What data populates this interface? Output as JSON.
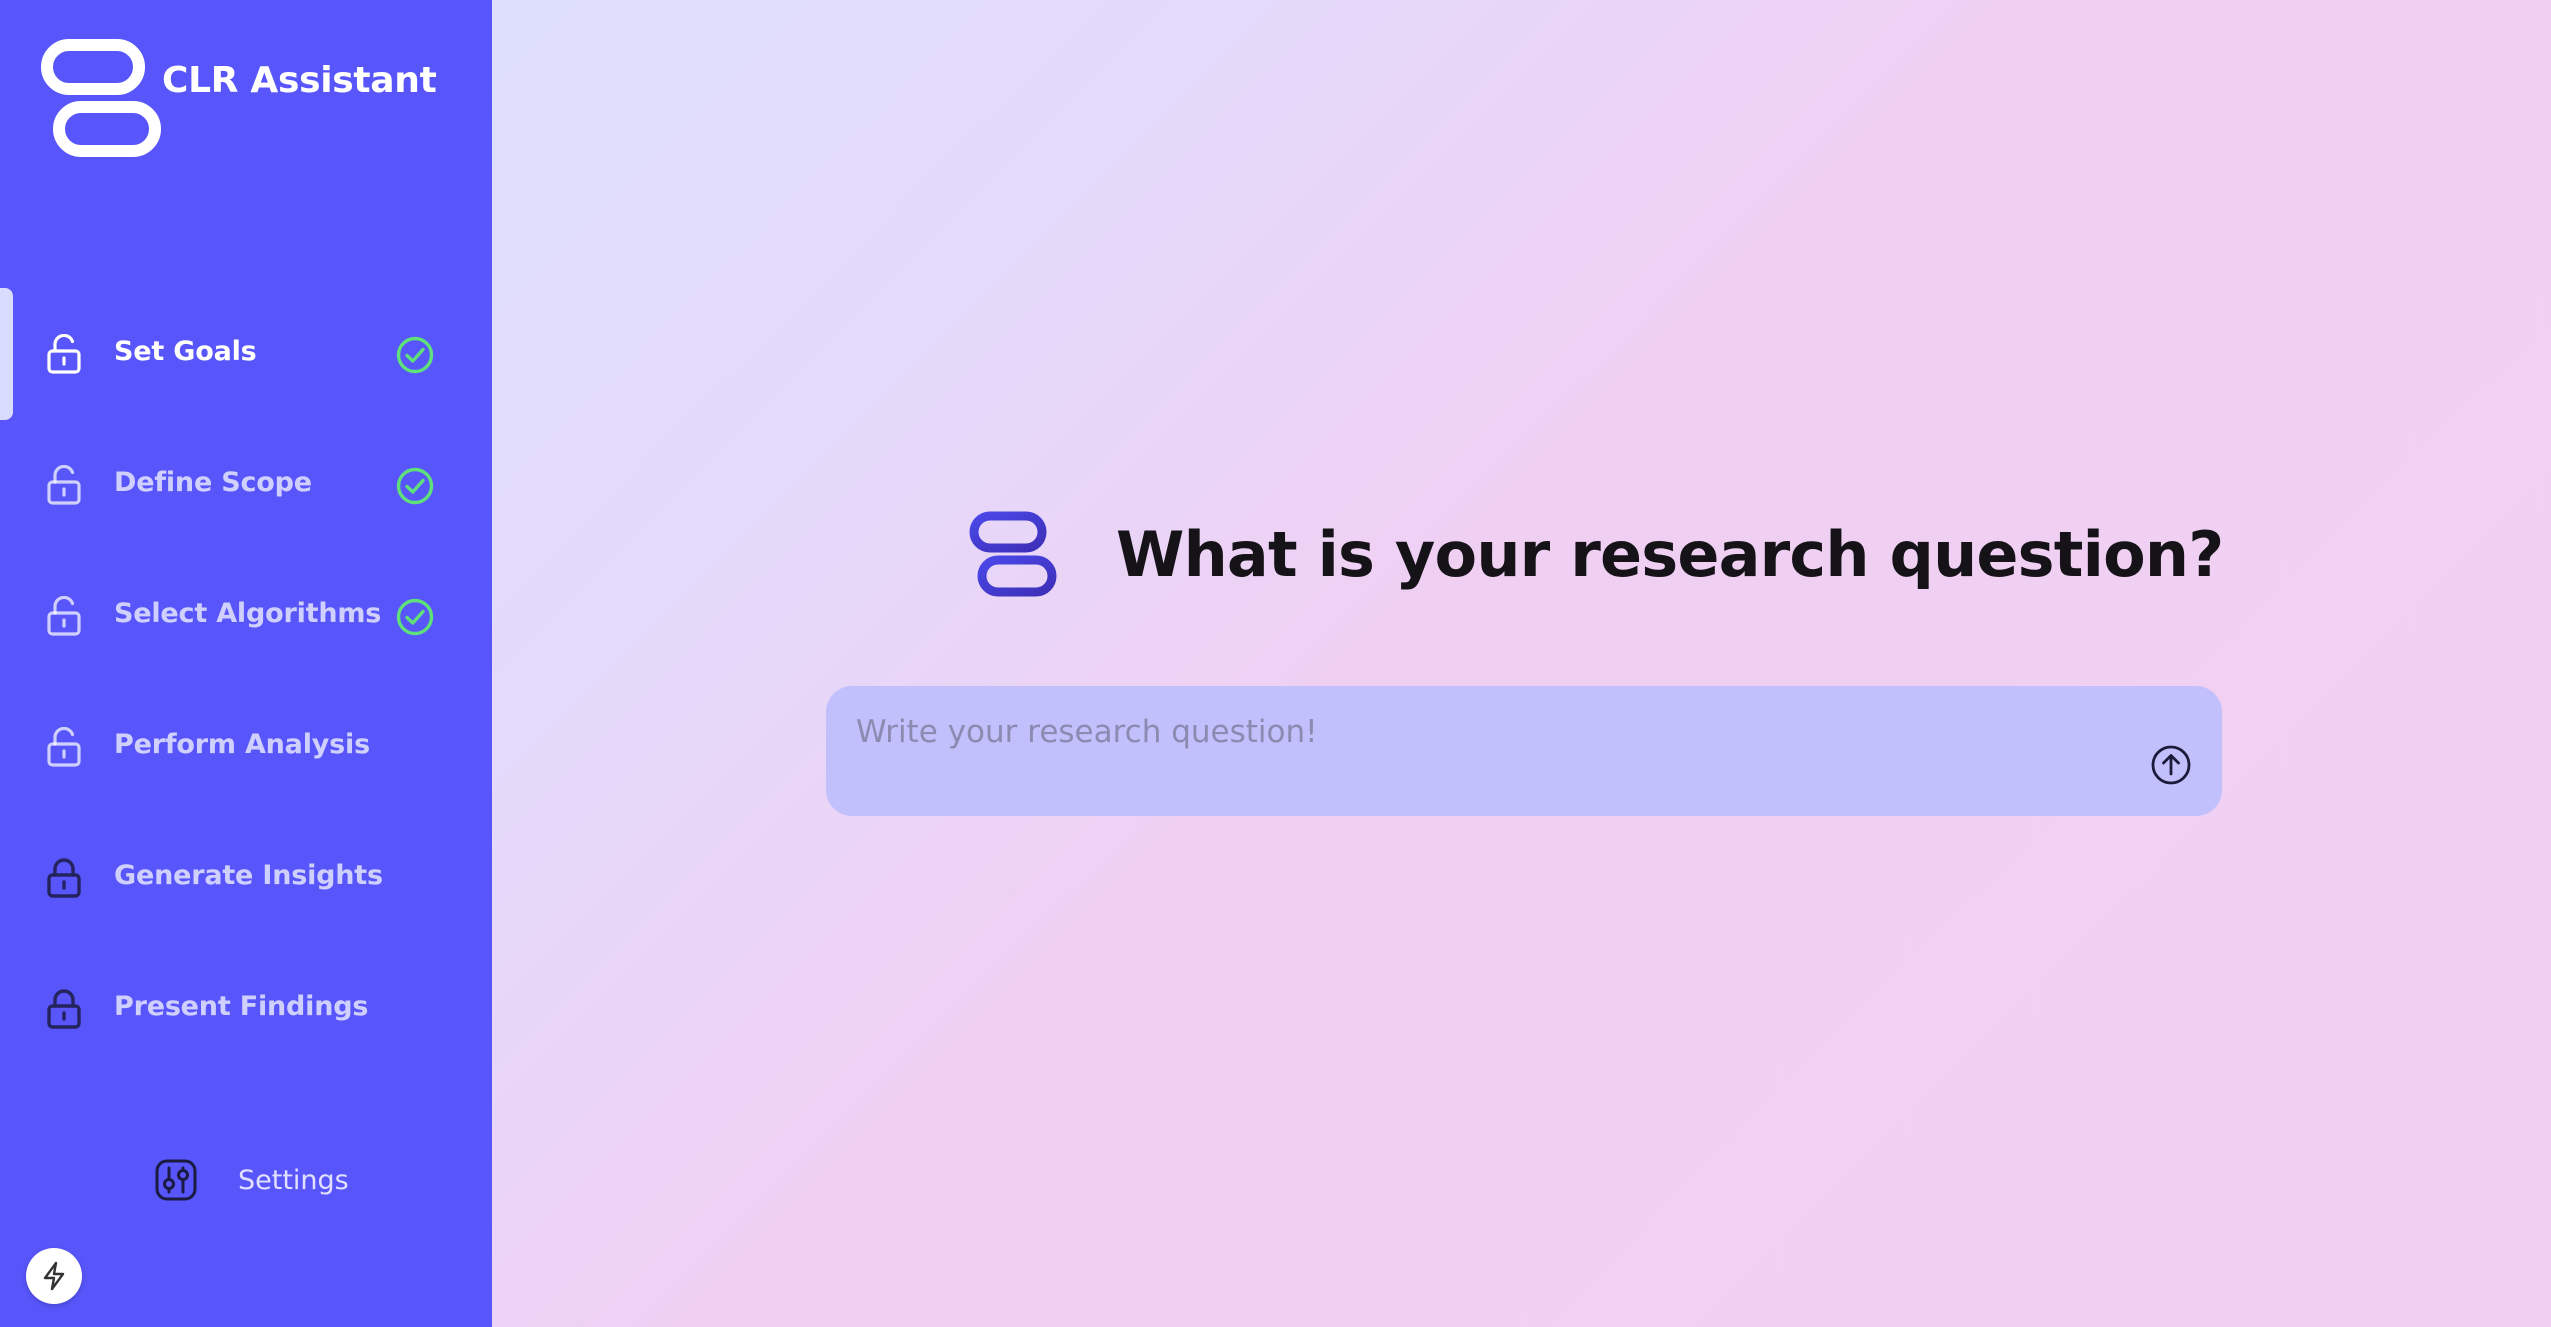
{
  "app": {
    "title": "CLR Assistant"
  },
  "sidebar": {
    "items": [
      {
        "label": "Set Goals",
        "lock": "unlocked",
        "completed": true,
        "active": true
      },
      {
        "label": "Define Scope",
        "lock": "unlocked",
        "completed": true,
        "active": false
      },
      {
        "label": "Select Algorithms",
        "lock": "unlocked",
        "completed": true,
        "active": false
      },
      {
        "label": "Perform Analysis",
        "lock": "unlocked",
        "completed": false,
        "active": false
      },
      {
        "label": "Generate Insights",
        "lock": "locked",
        "completed": false,
        "active": false
      },
      {
        "label": "Present Findings",
        "lock": "locked",
        "completed": false,
        "active": false
      }
    ],
    "settings_label": "Settings"
  },
  "main": {
    "heading": "What is your research question?",
    "input": {
      "placeholder": "Write your research question!",
      "value": ""
    }
  },
  "icons": {
    "brand": "app-logo-icon",
    "unlocked": "lock-open-icon",
    "locked": "lock-icon",
    "check": "check-circle-icon",
    "settings": "sliders-icon",
    "send": "arrow-up-circle-icon",
    "bolt": "bolt-icon"
  },
  "colors": {
    "sidebar": "#5856fb",
    "check": "#5ee07a",
    "input_bg": "#c1c0fc",
    "heading": "#161318"
  }
}
